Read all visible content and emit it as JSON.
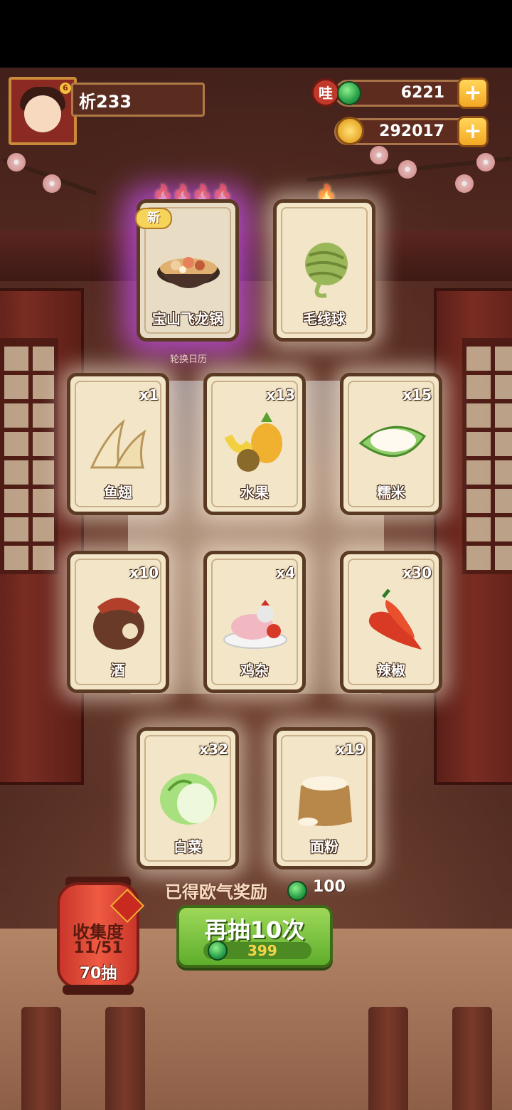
{
  "player": {
    "name": "析233"
  },
  "currency": {
    "jade": {
      "badge": "哇",
      "value": "6221",
      "plus": "+"
    },
    "coins": {
      "value": "292017",
      "plus": "+"
    }
  },
  "featured": {
    "new_tag": "新",
    "rotate_calendar": "轮换日历",
    "cards": [
      {
        "label": "宝山飞龙锅",
        "flames": "🔥🔥🔥🔥",
        "icon": "hotpot-icon",
        "rarity": "legendary"
      },
      {
        "label": "毛线球",
        "flames": "🔥",
        "icon": "yarn-ball-icon"
      }
    ]
  },
  "cards": [
    {
      "label": "鱼翅",
      "count": "x1",
      "icon": "shark-fin-icon"
    },
    {
      "label": "水果",
      "count": "x13",
      "icon": "fruit-icon"
    },
    {
      "label": "糯米",
      "count": "x15",
      "icon": "rice-icon"
    },
    {
      "label": "酒",
      "count": "x10",
      "icon": "wine-jar-icon"
    },
    {
      "label": "鸡杂",
      "count": "x4",
      "icon": "chicken-icon"
    },
    {
      "label": "辣椒",
      "count": "x30",
      "icon": "chili-icon"
    },
    {
      "label": "白菜",
      "count": "x32",
      "icon": "cabbage-icon"
    },
    {
      "label": "面粉",
      "count": "x19",
      "icon": "flour-sack-icon"
    }
  ],
  "reward": {
    "label": "已得欧气奖励",
    "value": "100"
  },
  "collection": {
    "title": "收集度",
    "progress": "11/51",
    "pulls": "70抽"
  },
  "draw_button": {
    "label": "再抽10次",
    "cost": "399"
  },
  "colors": {
    "accent_green": "#5fae2c",
    "legendary_glow": "#c850f0",
    "card_bg": "#f3e6c8"
  }
}
